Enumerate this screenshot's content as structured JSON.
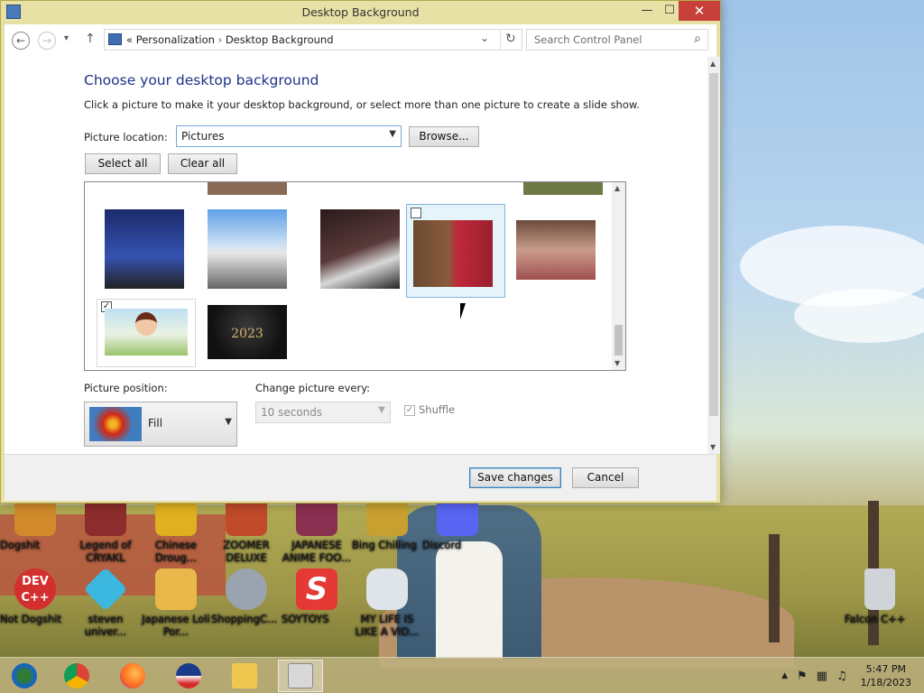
{
  "window": {
    "title": "Desktop Background",
    "minimize": "—",
    "maximize": "☐",
    "close": "✕"
  },
  "address": {
    "back": "←",
    "forward": "→",
    "recent": "▾",
    "up": "↑",
    "prefix": "«",
    "crumb1": "Personalization",
    "separator": "›",
    "crumb2": "Desktop Background",
    "dropdown": "⌄",
    "refresh": "↻",
    "search_placeholder": "Search Control Panel",
    "search_icon": "⌕"
  },
  "content": {
    "heading": "Choose your desktop background",
    "description": "Click a picture to make it your desktop background, or select more than one picture to create a slide show.",
    "location_label": "Picture location:",
    "location_value": "Pictures",
    "browse": "Browse...",
    "select_all": "Select all",
    "clear_all": "Clear all",
    "position_label": "Picture position:",
    "position_value": "Fill",
    "interval_label": "Change picture every:",
    "interval_value": "10 seconds",
    "shuffle": "Shuffle",
    "shuffle_mark": "✓",
    "checked_mark": "✓",
    "thumb_year": "2023"
  },
  "footer": {
    "save": "Save changes",
    "cancel": "Cancel"
  },
  "desktop_icons": [
    {
      "label": "Dogshit",
      "color": "#d08a2a"
    },
    {
      "label": "Legend of CRYAKL",
      "color": "#8d2c2c"
    },
    {
      "label": "Chinese Droug...",
      "color": "#e0b020"
    },
    {
      "label": "ZOOMER DELUXE",
      "color": "#c04a2a"
    },
    {
      "label": "JAPANESE ANIME FOO...",
      "color": "#8a3050"
    },
    {
      "label": "Bing Chilling",
      "color": "#c8a030"
    },
    {
      "label": "Discord",
      "color": "#5865f2"
    },
    {
      "label": "Not Dogshit",
      "color": "#d32f2f",
      "text": "DEV C++"
    },
    {
      "label": "steven univer...",
      "color": "#3bb7e0"
    },
    {
      "label": "Japanese Loli Por...",
      "color": "#e8b84a"
    },
    {
      "label": "ShoppingC...",
      "color": "#9aa4b0"
    },
    {
      "label": "SOYTOYS",
      "color": "#e53935",
      "text": "S"
    },
    {
      "label": "MY LIFE IS LIKE A VID...",
      "color": "#dfe3ea"
    },
    {
      "label": "Falcon C++",
      "color": "#d0d4d8"
    }
  ],
  "tray": {
    "up_arrow": "▲",
    "flag": "⚑",
    "network": "▦",
    "volume": "♫",
    "time": "5:47 PM",
    "date": "1/18/2023"
  }
}
